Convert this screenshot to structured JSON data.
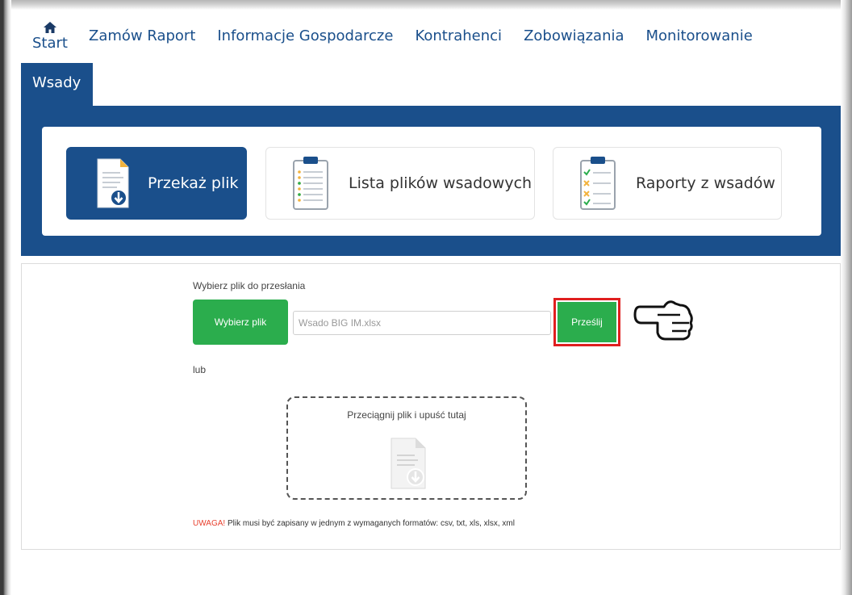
{
  "nav": {
    "start_label": "Start",
    "items": [
      {
        "label": "Zamów Raport"
      },
      {
        "label": "Informacje Gospodarcze"
      },
      {
        "label": "Kontrahenci"
      },
      {
        "label": "Zobowiązania"
      },
      {
        "label": "Monitorowanie"
      }
    ],
    "active_tab": "Wsady"
  },
  "tiles": [
    {
      "label": "Przekaż plik",
      "icon": "file-upload-icon",
      "active": true
    },
    {
      "label": "Lista plików wsadowych",
      "icon": "clipboard-list-icon",
      "active": false
    },
    {
      "label": "Raporty z wsadów",
      "icon": "clipboard-check-icon",
      "active": false
    }
  ],
  "upload": {
    "choose_label": "Wybierz plik do przesłania",
    "choose_button": "Wybierz plik",
    "file_value": "Wsado BIG IM.xlsx",
    "send_button": "Prześlij",
    "or_label": "lub",
    "dropzone_text": "Przeciągnij plik i upuść tutaj",
    "warning_prefix": "UWAGA!",
    "warning_text": " Plik musi być zapisany w jednym z wymaganych formatów: csv, txt, xls, xlsx, xml"
  },
  "colors": {
    "brand_blue": "#1a4f8b",
    "button_green": "#2bad4d",
    "highlight_red": "#e01f1f",
    "warning_red": "#e8412f"
  }
}
